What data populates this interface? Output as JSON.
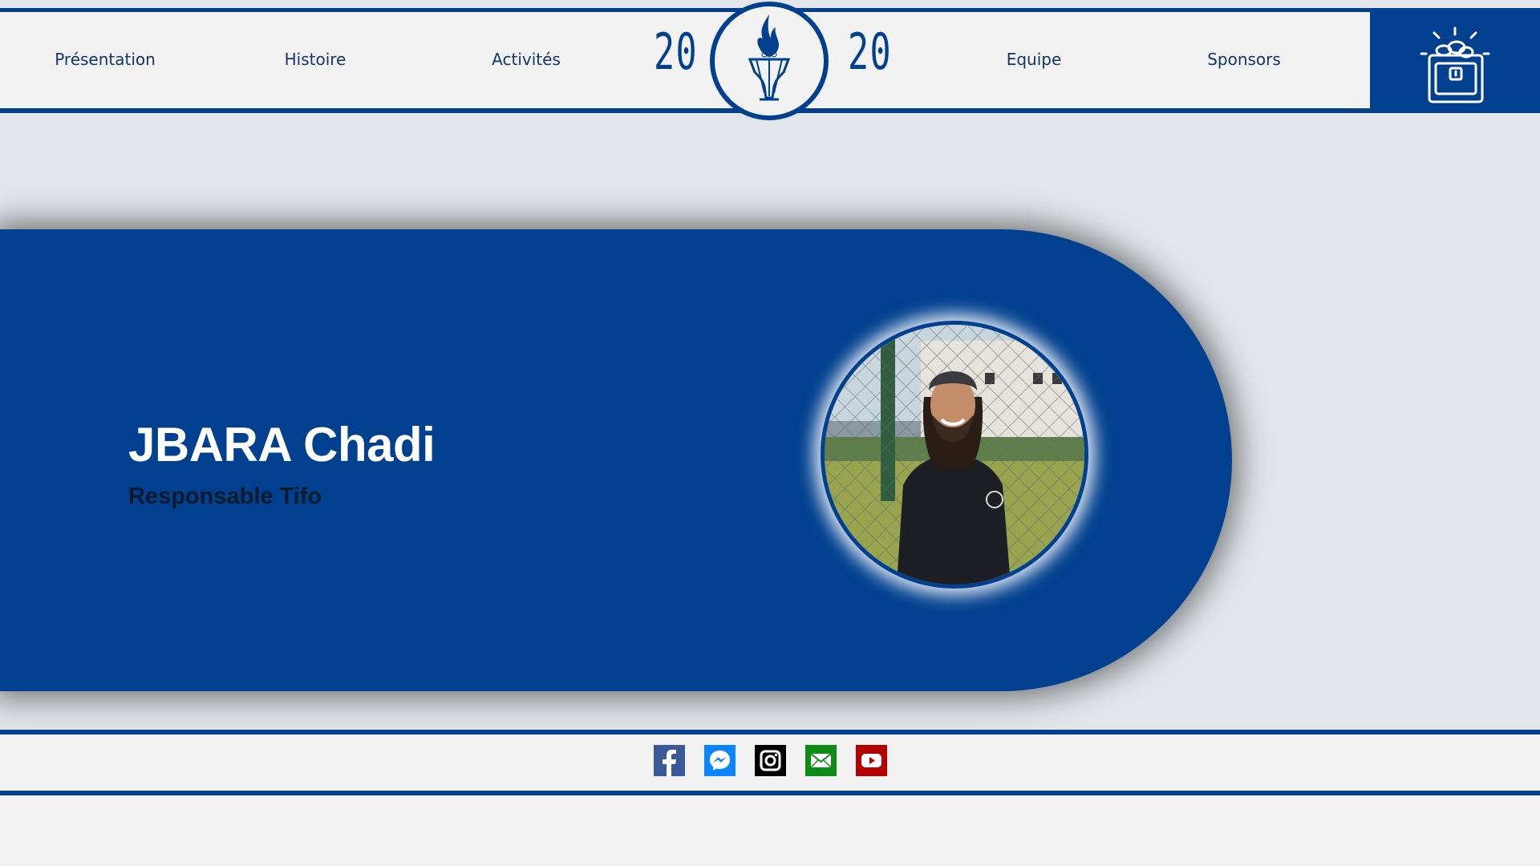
{
  "nav": {
    "items": [
      {
        "label": "Présentation"
      },
      {
        "label": "Histoire"
      },
      {
        "label": "Activités"
      },
      {
        "label": "Equipe"
      },
      {
        "label": "Sponsors"
      }
    ],
    "logo": {
      "year_left": "20",
      "year_right": "20",
      "icon": "torch-trophy-icon"
    },
    "cart": {
      "icon": "treasure-chest-icon"
    }
  },
  "member": {
    "name": "JBARA Chadi",
    "role": "Responsable Tifo",
    "photo_icon": "member-photo"
  },
  "footer": {
    "social": [
      {
        "name": "facebook-icon",
        "color": "#3b5998"
      },
      {
        "name": "messenger-icon",
        "color": "#0a84ff"
      },
      {
        "name": "instagram-icon",
        "color": "#000000"
      },
      {
        "name": "email-icon",
        "color": "#0e8a16"
      },
      {
        "name": "youtube-icon",
        "color": "#b30000"
      }
    ]
  },
  "colors": {
    "brand_blue": "#01408f",
    "background": "#e2e6eb",
    "bar": "#f2f2f2"
  }
}
